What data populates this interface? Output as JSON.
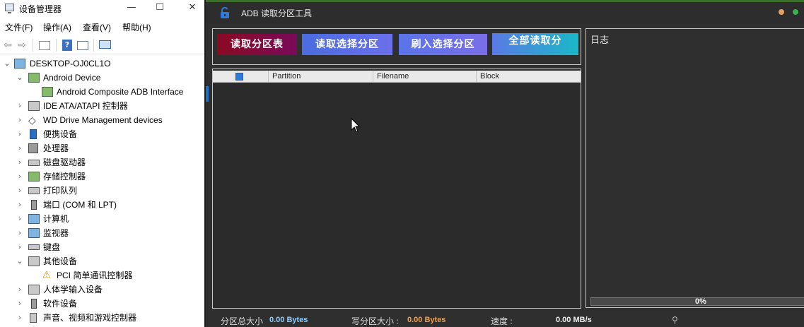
{
  "device_manager": {
    "title": "设备管理器",
    "window_buttons": [
      "—",
      "☐",
      "✕"
    ],
    "menus": [
      "文件(F)",
      "操作(A)",
      "查看(V)",
      "帮助(H)"
    ],
    "toolbar_icons": [
      "back-arrow-icon",
      "forward-arrow-icon",
      "properties-icon",
      "help-icon",
      "view-icon",
      "monitor-icon"
    ],
    "root": "DESKTOP-OJ0CL1O",
    "tree": [
      {
        "label": "Android Device",
        "level": 1,
        "expanded": true,
        "icon": "android-device-icon"
      },
      {
        "label": "Android Composite ADB Interface",
        "level": 2,
        "icon": "adb-interface-icon"
      },
      {
        "label": "IDE ATA/ATAPI 控制器",
        "level": 1,
        "icon": "ide-controller-icon"
      },
      {
        "label": "WD Drive Management devices",
        "level": 1,
        "icon": "wd-drive-icon"
      },
      {
        "label": "便携设备",
        "level": 1,
        "icon": "portable-device-icon"
      },
      {
        "label": "处理器",
        "level": 1,
        "icon": "processor-icon"
      },
      {
        "label": "磁盘驱动器",
        "level": 1,
        "icon": "disk-drive-icon"
      },
      {
        "label": "存储控制器",
        "level": 1,
        "icon": "storage-controller-icon"
      },
      {
        "label": "打印队列",
        "level": 1,
        "icon": "printer-icon"
      },
      {
        "label": "端口 (COM 和 LPT)",
        "level": 1,
        "icon": "port-icon"
      },
      {
        "label": "计算机",
        "level": 1,
        "icon": "computer-icon"
      },
      {
        "label": "监视器",
        "level": 1,
        "icon": "monitor-icon"
      },
      {
        "label": "键盘",
        "level": 1,
        "icon": "keyboard-icon"
      },
      {
        "label": "其他设备",
        "level": 1,
        "expanded": true,
        "icon": "other-device-icon"
      },
      {
        "label": "PCI 简单通讯控制器",
        "level": 2,
        "icon": "warning-device-icon"
      },
      {
        "label": "人体学输入设备",
        "level": 1,
        "icon": "hid-icon"
      },
      {
        "label": "软件设备",
        "level": 1,
        "icon": "software-device-icon"
      },
      {
        "label": "声音、视频和游戏控制器",
        "level": 1,
        "icon": "sound-icon"
      }
    ]
  },
  "adb_tool": {
    "title": "ADB 读取分区工具",
    "buttons": [
      {
        "label": "读取分区表",
        "color": "#8b0a3c"
      },
      {
        "label": "读取选择分区",
        "color": "#5b6fe6"
      },
      {
        "label": "刷入选择分区",
        "color": "#6b70e8"
      },
      {
        "label": "全部读取分",
        "color": "#4a9ad8"
      }
    ],
    "table_headers": [
      "Partition",
      "Filename",
      "Block"
    ],
    "log_title": "日志",
    "progress": {
      "value": 0,
      "label": "0%"
    },
    "status": {
      "partition_size_label": "分区总大小",
      "partition_size_value": "0.00 Bytes",
      "write_size_label": "写分区大小 :",
      "write_size_value": "0.00 Bytes",
      "speed_label": "速度 :",
      "speed_value": "0.00 MB/s"
    },
    "window_dots": [
      "#e8a060",
      "#3cb04c"
    ]
  }
}
